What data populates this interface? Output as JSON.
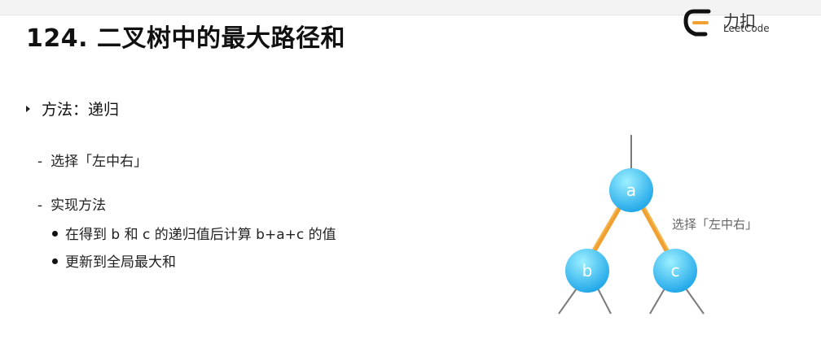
{
  "slide": {
    "title": "124. 二叉树中的最大路径和",
    "logo": {
      "cn": "力扣",
      "en": "LeetCode"
    },
    "bullet": {
      "label": "方法：递归"
    },
    "sub_items": [
      {
        "label": "选择「左中右」"
      },
      {
        "label": "实现方法"
      }
    ],
    "sub_sub_items": [
      {
        "label": "在得到 b 和 c 的递归值后计算 b+a+c 的值"
      },
      {
        "label": "更新到全局最大和"
      }
    ]
  },
  "diagram": {
    "nodes": [
      {
        "id": "a",
        "label": "a"
      },
      {
        "id": "b",
        "label": "b"
      },
      {
        "id": "c",
        "label": "c"
      }
    ],
    "annotation": "选择「左中右」",
    "colors": {
      "node_fill_top": "#7fe3ff",
      "node_fill_bottom": "#1fa6e6",
      "highlight": "#f0a030",
      "edge": "#7a7a7a"
    }
  }
}
